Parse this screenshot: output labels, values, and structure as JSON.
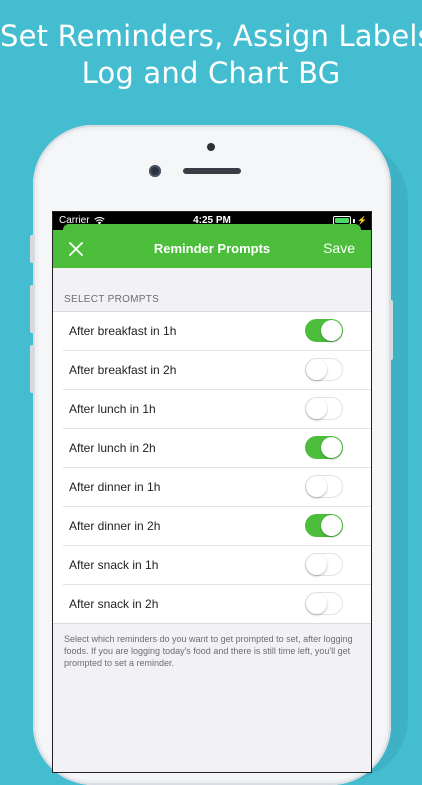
{
  "headline": {
    "line1": "Set Reminders, Assign Labels",
    "line2": "Log and Chart BG"
  },
  "status_bar": {
    "carrier": "Carrier",
    "time": "4:25 PM"
  },
  "nav": {
    "title": "Reminder Prompts",
    "save_label": "Save"
  },
  "section": {
    "header": "SELECT PROMPTS",
    "items": [
      {
        "label": "After breakfast in 1h",
        "enabled": true
      },
      {
        "label": "After breakfast in 2h",
        "enabled": false
      },
      {
        "label": "After lunch in 1h",
        "enabled": false
      },
      {
        "label": "After lunch in 2h",
        "enabled": true
      },
      {
        "label": "After dinner in 1h",
        "enabled": false
      },
      {
        "label": "After dinner in 2h",
        "enabled": true
      },
      {
        "label": "After snack in 1h",
        "enabled": false
      },
      {
        "label": "After snack in 2h",
        "enabled": false
      }
    ],
    "footer": "Select which reminders do you want to get prompted to set, after logging foods. If you are logging today's food and there is still time left, you'll get prompted to set a reminder."
  },
  "colors": {
    "background": "#45bdd0",
    "accent": "#4cbe3c"
  }
}
